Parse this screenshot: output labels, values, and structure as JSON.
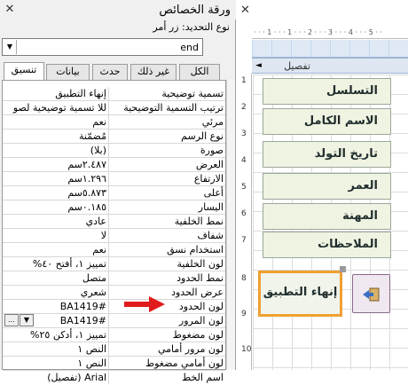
{
  "property_sheet": {
    "title": "ورقة الخصائص",
    "close_glyph": "✕",
    "selection_type": "نوع التحديد:  زر أمر",
    "object_combo": {
      "value": "end"
    },
    "tabs": [
      "الكل",
      "غير ذلك",
      "حدث",
      "بيانات",
      "تنسيق"
    ],
    "active_tab": "تنسيق",
    "properties": [
      {
        "name": "تسمية توضيحية",
        "value": "إنهاء التطبيق"
      },
      {
        "name": "ترتيب التسمية التوضيحية",
        "value": "للا تسمية توضيحية لصو"
      },
      {
        "name": "مرئي",
        "value": "نعم"
      },
      {
        "name": "نوع الرسم",
        "value": "مُضمّنة"
      },
      {
        "name": "صورة",
        "value": "(بلا)"
      },
      {
        "name": "العرض",
        "value": "٢.٤٨٧سم"
      },
      {
        "name": "الارتفاع",
        "value": "١.٢٩٦سم"
      },
      {
        "name": "أعلى",
        "value": "٥.٨٧٣سم"
      },
      {
        "name": "اليسار",
        "value": "٠.١٨٥سم"
      },
      {
        "name": "نمط الخلفية",
        "value": "عادي"
      },
      {
        "name": "شفاف",
        "value": "لا"
      },
      {
        "name": "استخدام نسق",
        "value": "نعم"
      },
      {
        "name": "لون الخلفية",
        "value": "تمييز ١، أفتح ٤٠%"
      },
      {
        "name": "نمط الحدود",
        "value": "متصل"
      },
      {
        "name": "عرض الحدود",
        "value": "شعري"
      },
      {
        "name": "لون الحدود",
        "value": "#BA1419"
      },
      {
        "name": "لون المرور",
        "value": "#BA1419"
      },
      {
        "name": "لون مضغوط",
        "value": "تمييز ١، أدكن ٢٥%"
      },
      {
        "name": "لون مرور أمامي",
        "value": "النص ١"
      },
      {
        "name": "لون أمامي مضغوط",
        "value": "النص ١"
      },
      {
        "name": "اسم الخط",
        "value": "Arial (تفصيل)"
      }
    ]
  },
  "design_view": {
    "close_glyph": "✕",
    "section_label": "تفصيل",
    "ruler_top_text": "· · · 1 · · · 1 · · · 2 · · · 3 · · · 4 · · · 5 · ·",
    "ruler_numbers": [
      "1",
      "2",
      "3",
      "4",
      "5",
      "6",
      "7",
      "8",
      "9",
      "10"
    ],
    "fields": [
      "التسلسل",
      "الاسم الكامل",
      "تاريخ التولد",
      "العمر",
      "المهنة",
      "الملاحظات"
    ],
    "end_button_label": "إنهاء التطبيق"
  },
  "colors": {
    "arrow": "#e11b1b",
    "button_border": "#f0a030",
    "field_background": "#eff3e1"
  }
}
